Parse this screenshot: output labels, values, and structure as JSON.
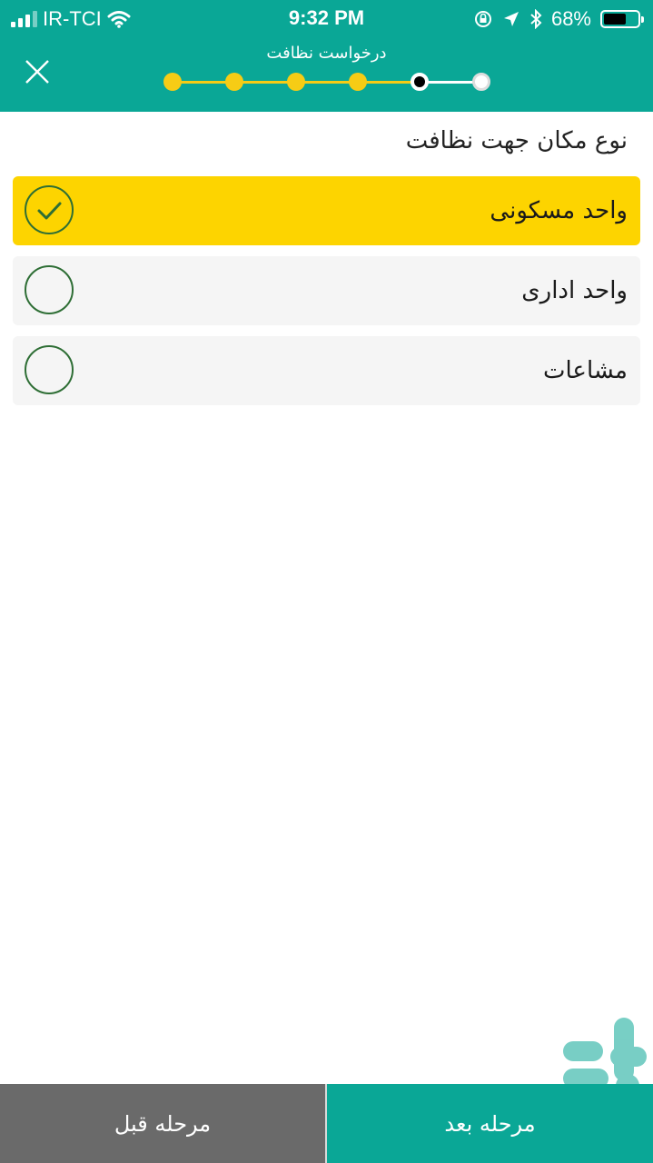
{
  "status_bar": {
    "carrier": "IR-TCI",
    "time": "9:32 PM",
    "battery_percent": "68%",
    "battery_level": 0.68
  },
  "header": {
    "title": "درخواست نظافت",
    "close_icon": "close-icon",
    "progress": {
      "total_steps": 6,
      "current_step": 5,
      "completed_color": "#f6cc15",
      "current_color": "#000000",
      "pending_color": "#ffffff"
    }
  },
  "main": {
    "section_title": "نوع مکان جهت نظافت",
    "options": [
      {
        "label": "واحد مسکونی",
        "selected": true
      },
      {
        "label": "واحد اداری",
        "selected": false
      },
      {
        "label": "مشاعات",
        "selected": false
      }
    ]
  },
  "footer": {
    "next_label": "مرحله بعد",
    "prev_label": "مرحله قبل"
  },
  "colors": {
    "primary": "#0aa796",
    "accent": "#fdd400",
    "radio_border": "#2e6e35",
    "option_bg": "#f5f5f5",
    "prev_button": "#6a6a6a"
  },
  "watermark": {
    "icon": "bazaar-logo-icon"
  }
}
